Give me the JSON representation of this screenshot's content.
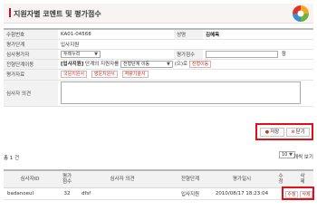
{
  "header": {
    "title": "지원자별 코멘트 및 평가점수"
  },
  "form": {
    "exam_no_label": "수험번호",
    "exam_no_value": "KA01-04568",
    "name_label": "성명",
    "name_value": "김혜옥",
    "stage_label": "평가단계",
    "stage_value": "입사지원",
    "reviewer_label": "심사평가자",
    "reviewer_select": "두레누리",
    "score_label": "평가점수",
    "score_unit": "점",
    "move_label": "전형단계이동",
    "move_text_bold": "[입사지원]",
    "move_text_1": "단계의 지원자를",
    "move_select": "전형단계 이동",
    "move_text_2": "(으)로",
    "move_link": "전형이동",
    "docs_label": "평가자료",
    "docs": [
      "국문지원서",
      "영문지원서",
      "역량기술서"
    ],
    "opinion_label": "심사자 의견"
  },
  "actions": {
    "save": "저장",
    "close": "닫기"
  },
  "list": {
    "total_text": "총 1 건",
    "per_page": "10",
    "per_page_label": "개씩 보기",
    "headers": [
      "심사자ID",
      "평가\n점수",
      "심사자 의견",
      "전형단계",
      "평가일시",
      "수\n정",
      "삭\n제"
    ],
    "rows": [
      {
        "id": "badanoeul",
        "score": "32",
        "opinion": "dfsf",
        "stage": "입사지원",
        "datetime": "2010/08/17 18:23:04",
        "edit": "수정",
        "delete": "삭제"
      }
    ]
  }
}
